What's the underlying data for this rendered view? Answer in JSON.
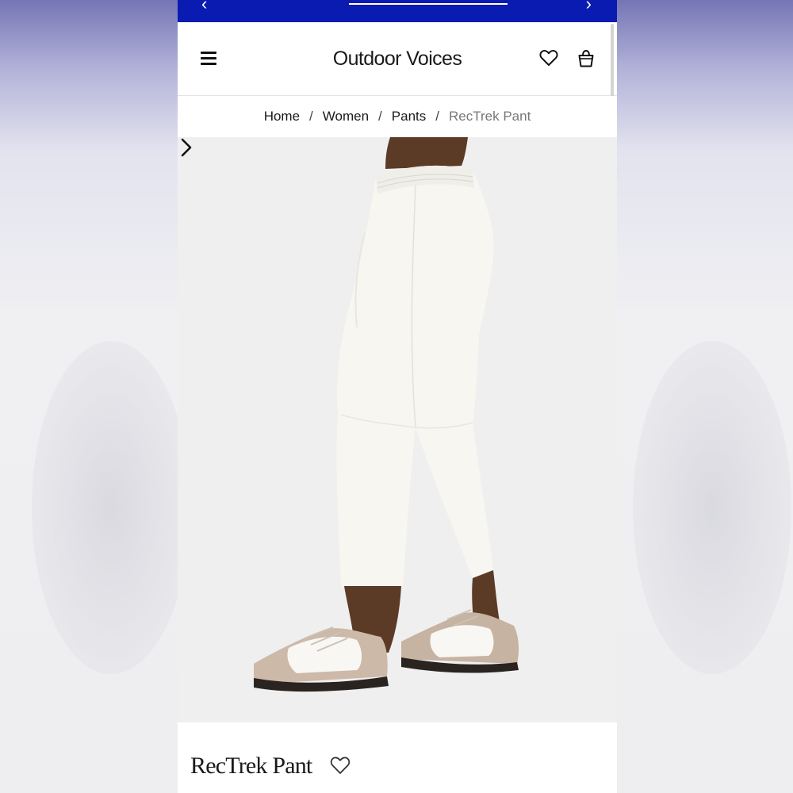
{
  "header": {
    "brand": "Outdoor Voices",
    "icons": [
      "menu-icon",
      "heart-icon",
      "bag-icon"
    ]
  },
  "breadcrumb": {
    "items": [
      "Home",
      "Women",
      "Pants"
    ],
    "current": "RecTrek Pant",
    "separator": "/"
  },
  "product": {
    "title": "RecTrek Pant",
    "image_alt": "Model wearing white cropped pants with tan and white sneakers"
  },
  "colors": {
    "promo_bar": "#0a1bb1",
    "image_background": "#efefef",
    "current_crumb": "#777777"
  }
}
